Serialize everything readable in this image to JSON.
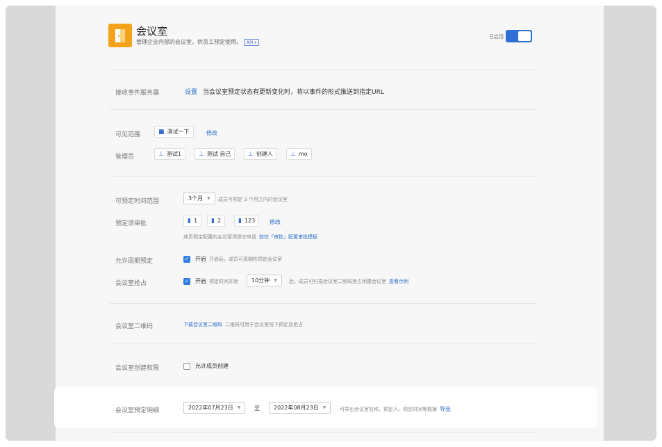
{
  "app": {
    "title": "会议室",
    "subtitle": "管理企业内部的会议室，供员工预定使用。",
    "api_badge": "API",
    "enabled_label": "已启用",
    "enabled": true,
    "icon": "door-icon",
    "icon_color": "#f4a11b"
  },
  "receive_server": {
    "label": "接收事件服务器",
    "set_link": "设置",
    "desc": "当会议室预定状态有更新变化时，将以事件的形式推送到指定URL"
  },
  "visible_range": {
    "label": "可见范围",
    "items": [
      "测试一下"
    ],
    "modify": "修改"
  },
  "admins": {
    "label": "管理员",
    "items": [
      "测试1",
      "测试 自己",
      "创建人",
      "mo"
    ]
  },
  "booking_range": {
    "label": "可预定时间范围",
    "value": "3个月",
    "hint": "成员可预定 3 个月之内的会议室"
  },
  "approval": {
    "label": "预定须审批",
    "items": [
      "1",
      "2",
      "123"
    ],
    "modify": "修改",
    "hint": "成员预定配置的会议室须提交申请",
    "link": "前往「审批」配置审批模板"
  },
  "periodic": {
    "label": "允许周期预定",
    "check_label": "开启",
    "checked": true,
    "hint": "开启后，成员可周期性预定会议室"
  },
  "grab": {
    "label": "会议室抢占",
    "check_label": "开启",
    "checked": true,
    "prefix": "预定时间开始",
    "value": "10分钟",
    "suffix": "后，成员可扫描会议室二维码抢占闲置会议室",
    "example_link": "查看示例"
  },
  "qrcode": {
    "label": "会议室二维码",
    "link": "下载会议室二维码",
    "hint": "二维码可用于会议室线下预定及抢占"
  },
  "create_perm": {
    "label": "会议室创建权限",
    "check_label": "允许成员创建",
    "checked": false
  },
  "details": {
    "label": "会议室预定明细",
    "start_date": "2022年07月23日",
    "to": "至",
    "end_date": "2022年08月23日",
    "hint": "可导出会议室名称、预定人、预定时间等数据",
    "export": "导出"
  },
  "colors": {
    "accent": "#2f6fd6",
    "link": "#2a6dc9"
  }
}
